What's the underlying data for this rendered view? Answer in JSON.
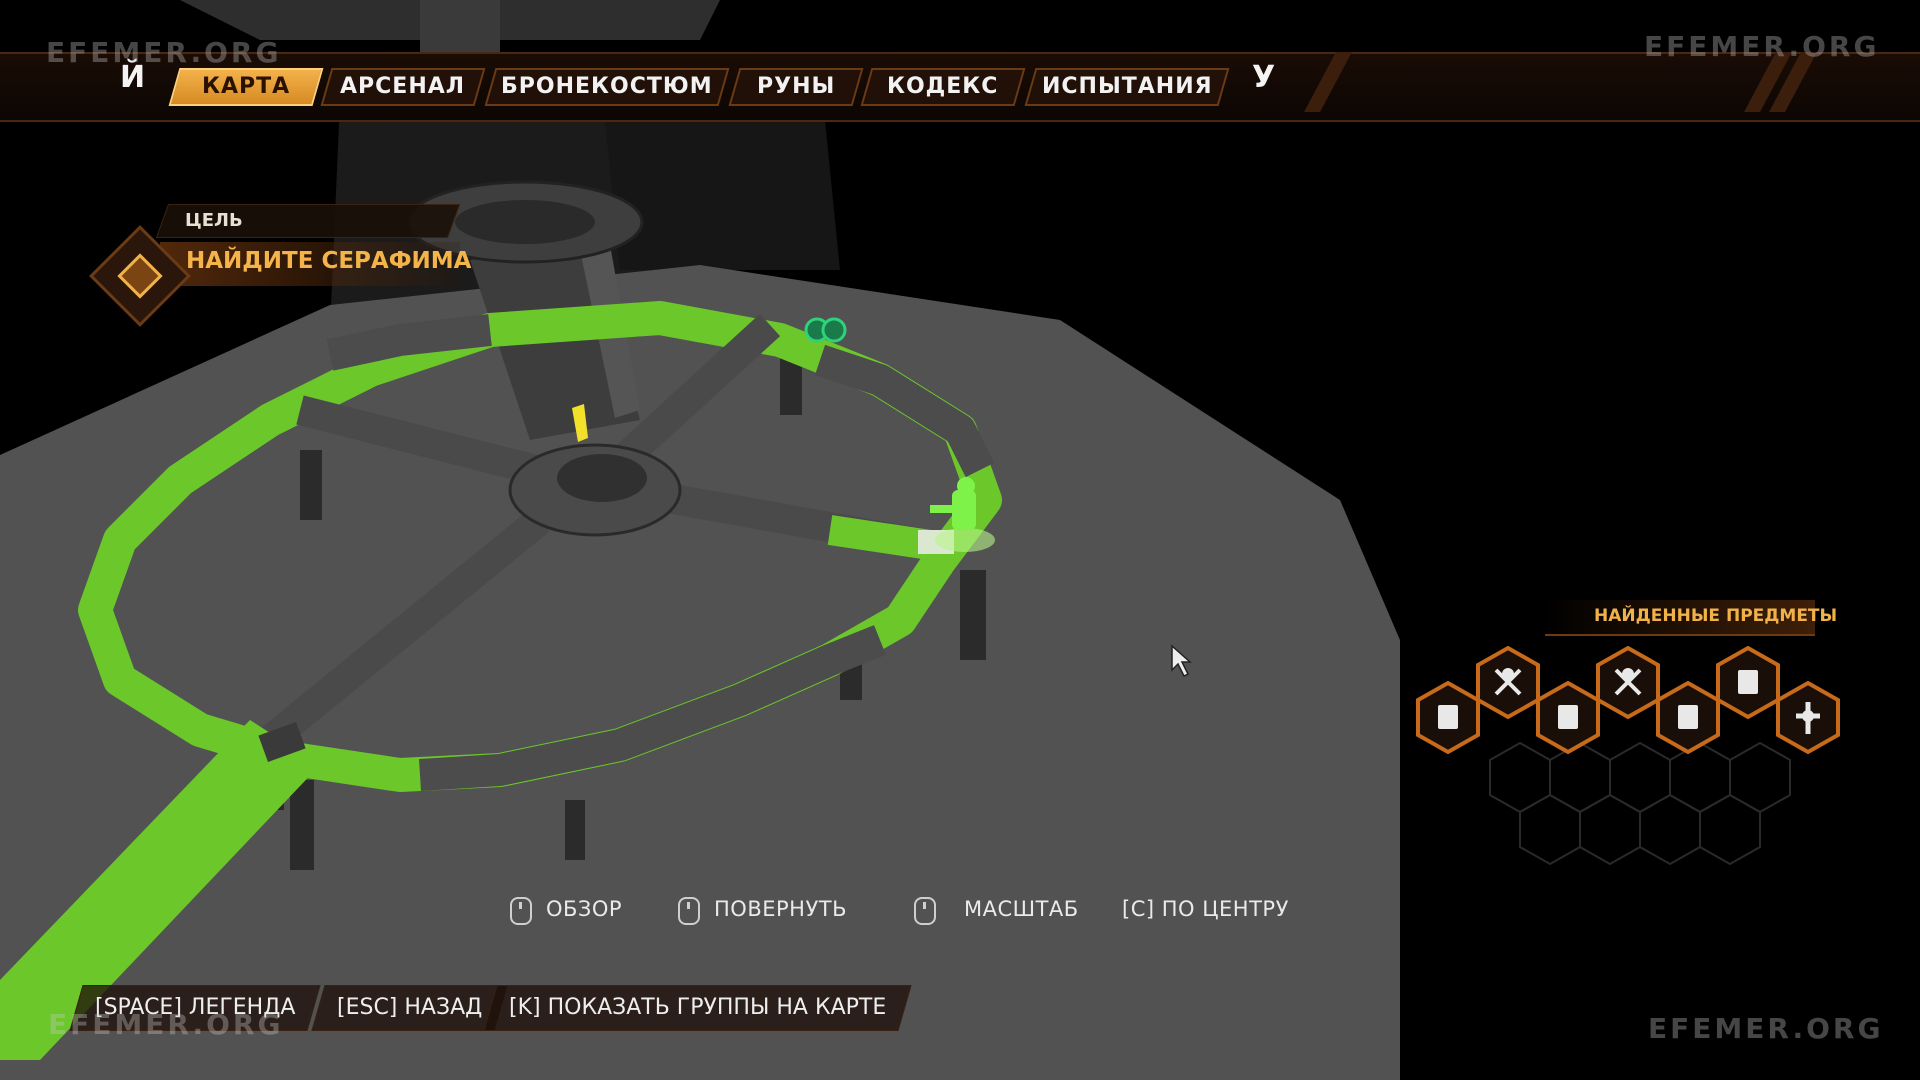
{
  "tabs": [
    {
      "label": "КАРТА",
      "active": true
    },
    {
      "label": "АРСЕНАЛ",
      "active": false
    },
    {
      "label": "БРОНЕКОСТЮМ",
      "active": false
    },
    {
      "label": "РУНЫ",
      "active": false
    },
    {
      "label": "КОДЕКС",
      "active": false
    },
    {
      "label": "ИСПЫТАНИЯ",
      "active": false
    }
  ],
  "tab_prev_key": "Й",
  "tab_next_key": "У",
  "objective": {
    "label": "ЦЕЛЬ",
    "text": "НАЙДИТЕ СЕРАФИМА"
  },
  "controls": {
    "overview": "ОБЗОР",
    "rotate": "ПОВЕРНУТЬ",
    "zoom": "МАСШТАБ",
    "center": "[C] ПО ЦЕНТРУ"
  },
  "bottom_buttons": {
    "legend": "[SPACE] ЛЕГЕНДА",
    "back": "[ESC] НАЗАД",
    "groups": "[K] ПОКАЗАТЬ ГРУППЫ НА КАРТЕ"
  },
  "found_items": {
    "title": "НАЙДЕННЫЕ ПРЕДМЕТЫ",
    "icons": [
      "codex-icon",
      "challenge-icon",
      "codex-icon",
      "challenge-icon",
      "codex-icon",
      "codex-icon",
      "secret-icon"
    ]
  },
  "watermark": "EFEMER.ORG",
  "colors": {
    "accent": "#f2b24a",
    "explored": "#6cc82a",
    "unexplored": "#4a4a4a"
  }
}
